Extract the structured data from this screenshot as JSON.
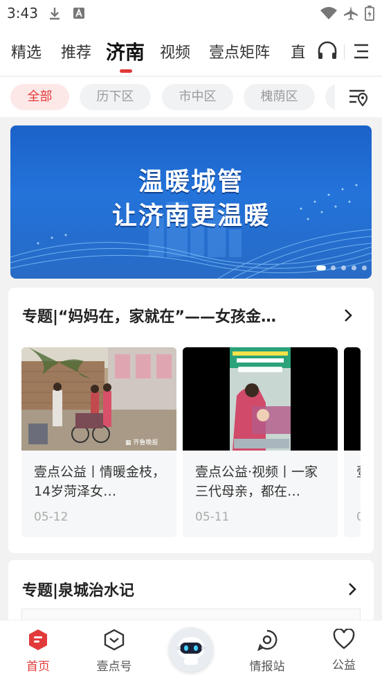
{
  "status_bar": {
    "time": "3:43"
  },
  "top_nav": {
    "tabs": [
      "精选",
      "推荐",
      "济南",
      "视频",
      "壹点矩阵",
      "直"
    ],
    "active_tab": "济南",
    "icons": {
      "audio": "headphones-icon",
      "menu": "menu-icon"
    }
  },
  "districts": {
    "chips": [
      "全部",
      "历下区",
      "市中区",
      "槐荫区"
    ],
    "active": "全部",
    "filter_icon": "location-filter-icon"
  },
  "banner": {
    "line1": "温暖城管",
    "line2": "让济南更温暖",
    "slide_count": 5,
    "active_slide": 1
  },
  "topic_card_1": {
    "title": "专题|“妈妈在，家就在”——女孩金…",
    "items": [
      {
        "title": "壹点公益丨情暖金枝，14岁菏泽女…",
        "date": "05-12",
        "image": "family-courtyard-photo"
      },
      {
        "title": "壹点公益·视频丨一家三代母亲，都在…",
        "date": "05-11",
        "image": "video-screenshot"
      },
      {
        "title": "壹",
        "date": "0",
        "image": ""
      }
    ]
  },
  "topic_card_2": {
    "title": "专题|泉城治水记"
  },
  "bottom_nav": {
    "items": [
      {
        "label": "首页",
        "icon": "home-icon",
        "active": true
      },
      {
        "label": "壹点号",
        "icon": "yidian-icon",
        "active": false
      },
      {
        "label": "",
        "icon": "robot-assistant-icon",
        "active": false
      },
      {
        "label": "情报站",
        "icon": "intel-icon",
        "active": false
      },
      {
        "label": "公益",
        "icon": "heart-icon",
        "active": false
      }
    ]
  },
  "colors": {
    "accent": "#e23a3a",
    "banner_blue": "#1f6fd8"
  }
}
